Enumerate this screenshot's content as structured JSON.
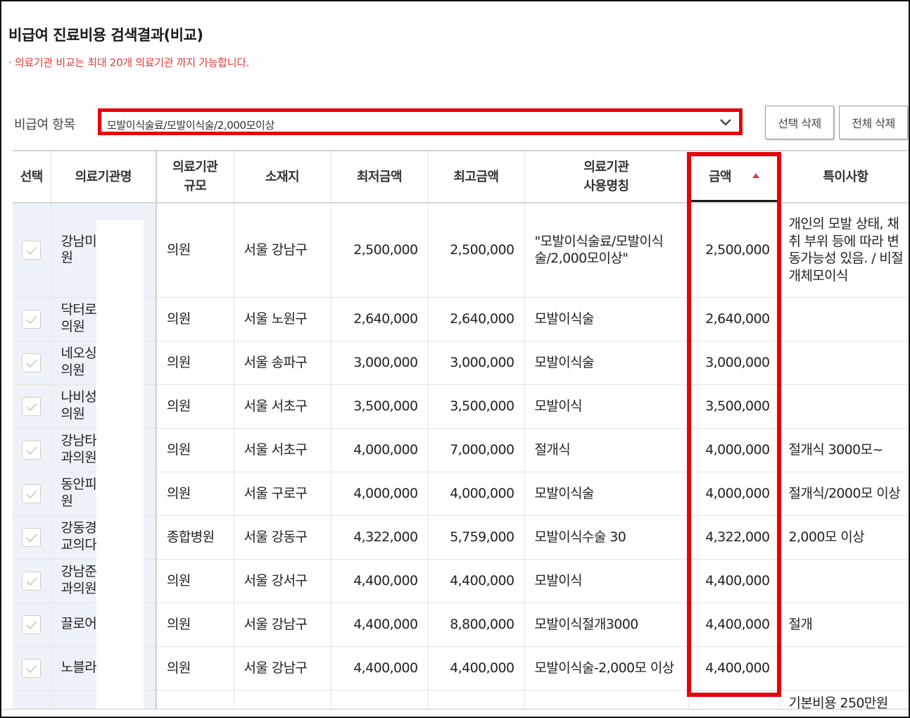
{
  "header": {
    "title": "비급여 진료비용 검색결과(비교)",
    "notice": "· 의료기관 비교는 최대 20개 의료기관 까지 가능합니다."
  },
  "filter": {
    "label": "비급여 항목",
    "selected": "모발이식술료/모발이식술/2,000모이상",
    "icon": "chevron-down-icon"
  },
  "buttons": {
    "delete_selected": "선택 삭제",
    "delete_all": "전체 삭제"
  },
  "table": {
    "headers": {
      "select": "선택",
      "name": "의료기관명",
      "scale_line1": "의료기관",
      "scale_line2": "규모",
      "location": "소재지",
      "min": "최저금액",
      "max": "최고금액",
      "use_line1": "의료기관",
      "use_line2": "사용명칭",
      "amount": "금액",
      "note": "특이사항"
    },
    "sort": {
      "column": "금액",
      "direction": "asc",
      "indicator_color": "#e03a3a"
    },
    "rows": [
      {
        "name": "강남미 원",
        "scale": "의원",
        "location": "서울 강남구",
        "min": "2,500,000",
        "max": "2,500,000",
        "use": "\"모발이식술료/모발이식술/2,000모이상\"",
        "amount": "2,500,000",
        "note": "개인의 모발 상태, 채취 부위 등에 따라 변동가능성 있음. / 비절개체모이식"
      },
      {
        "name": "닥터로 의원",
        "scale": "의원",
        "location": "서울 노원구",
        "min": "2,640,000",
        "max": "2,640,000",
        "use": "모발이식술",
        "amount": "2,640,000",
        "note": ""
      },
      {
        "name": "네오싱 의원",
        "scale": "의원",
        "location": "서울 송파구",
        "min": "3,000,000",
        "max": "3,000,000",
        "use": "모발이식술",
        "amount": "3,000,000",
        "note": ""
      },
      {
        "name": "나비성 의원",
        "scale": "의원",
        "location": "서울 서초구",
        "min": "3,500,000",
        "max": "3,500,000",
        "use": "모발이식",
        "amount": "3,500,000",
        "note": ""
      },
      {
        "name": "강남타 과의원",
        "scale": "의원",
        "location": "서울 서초구",
        "min": "4,000,000",
        "max": "7,000,000",
        "use": "절개식",
        "amount": "4,000,000",
        "note": "절개식 3000모~"
      },
      {
        "name": "동안피 원",
        "scale": "의원",
        "location": "서울 구로구",
        "min": "4,000,000",
        "max": "4,000,000",
        "use": "모발이식술",
        "amount": "4,000,000",
        "note": "절개식/2000모 이상"
      },
      {
        "name": "강동경 교의다",
        "scale": "종합병원",
        "location": "서울 강동구",
        "min": "4,322,000",
        "max": "5,759,000",
        "use": "모발이식수술 30",
        "amount": "4,322,000",
        "note": "2,000모 이상"
      },
      {
        "name": "강남준 과의원",
        "scale": "의원",
        "location": "서울 강서구",
        "min": "4,400,000",
        "max": "4,400,000",
        "use": "모발이식",
        "amount": "4,400,000",
        "note": ""
      },
      {
        "name": "끌로어",
        "scale": "의원",
        "location": "서울 강남구",
        "min": "4,400,000",
        "max": "8,800,000",
        "use": "모발이식절개3000",
        "amount": "4,400,000",
        "note": "절개"
      },
      {
        "name": "노블라",
        "scale": "의원",
        "location": "서울 강남구",
        "min": "4,400,000",
        "max": "4,400,000",
        "use": "모발이식술-2,000모 이상",
        "amount": "4,400,000",
        "note": ""
      },
      {
        "name": "",
        "scale": "",
        "location": "",
        "min": "",
        "max": "",
        "use": "",
        "amount": "",
        "note": "기본비용 250만원"
      }
    ]
  },
  "colors": {
    "highlight_red": "#e8000b",
    "notice_red": "#e03a3a",
    "left_column_bg": "#edf2f9"
  }
}
